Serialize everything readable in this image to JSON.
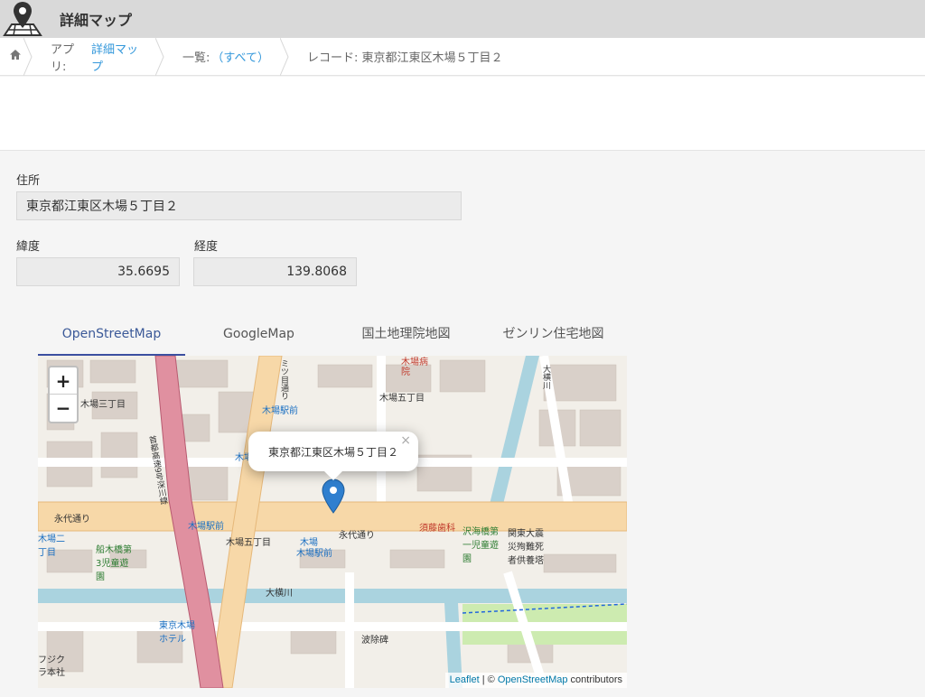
{
  "header": {
    "title": "詳細マップ",
    "icon": "map-pin-icon"
  },
  "breadcrumb": {
    "home_icon": "home-icon",
    "app_prefix": "アプリ:",
    "app_name": "詳細マップ",
    "list_prefix": "一覧:",
    "list_name": "（すべて）",
    "record_label": "レコード: 東京都江東区木場５丁目２"
  },
  "fields": {
    "address_label": "住所",
    "address_value": "東京都江東区木場５丁目２",
    "lat_label": "緯度",
    "lat_value": "35.6695",
    "lng_label": "経度",
    "lng_value": "139.8068"
  },
  "tabs": [
    {
      "label": "OpenStreetMap",
      "active": true
    },
    {
      "label": "GoogleMap",
      "active": false
    },
    {
      "label": "国土地理院地図",
      "active": false
    },
    {
      "label": "ゼンリン住宅地図",
      "active": false
    }
  ],
  "map": {
    "zoom_in": "+",
    "zoom_out": "−",
    "popup_text": "東京都江東区木場５丁目２",
    "popup_close": "×",
    "attribution_leaflet": "Leaflet",
    "attribution_sep": " | © ",
    "attribution_osm": "OpenStreetMap",
    "attribution_suffix": " contributors",
    "labels": {
      "l1": "木場三丁目",
      "l2": "木場五丁目",
      "l3": "木場駅前",
      "l4": "永代通り",
      "l5": "永代通り",
      "l6": "木場駅前",
      "l7": "木場五丁目",
      "l8": "木場",
      "l9": "木場駅前",
      "l10": "須藤歯科",
      "l11": "沢海橋第一児童遊園",
      "l12": "関東大震災殉難死者供養塔",
      "l13": "船木橋第3児童遊園",
      "l14": "大横川",
      "l15": "東京木場ホテル",
      "l16": "波除碑",
      "l17": "首都高速9号深川線",
      "l18": "大横川",
      "l19": "木場病院",
      "l20": "ミツ目通り",
      "l21": "木場二丁目",
      "l22": "フジク",
      "l23": "ラ本社",
      "l24": "木場駅前"
    }
  },
  "colors": {
    "accent": "#3b4fa0",
    "link": "#3498db",
    "header_bg": "#d9d9d9"
  }
}
